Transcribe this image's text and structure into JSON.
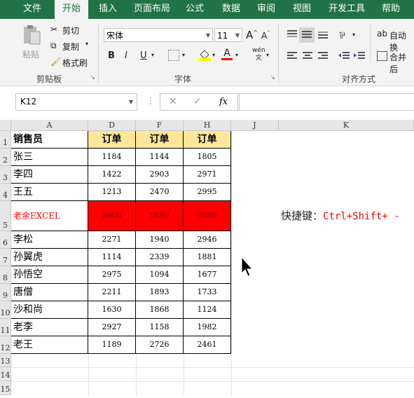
{
  "tabs": [
    "文件",
    "开始",
    "插入",
    "页面布局",
    "公式",
    "数据",
    "审阅",
    "视图",
    "开发工具",
    "帮助"
  ],
  "active_tab": "开始",
  "clipboard": {
    "paste": "粘贴",
    "cut": "剪切",
    "copy": "复制",
    "format_painter": "格式刷",
    "group": "剪贴板"
  },
  "font": {
    "name": "宋体",
    "size": "11",
    "bold": "B",
    "italic": "I",
    "underline": "U",
    "wen": "wén\n文",
    "group": "字体"
  },
  "align": {
    "wrap": "自动换",
    "merge": "合并后",
    "group": "对齐方式"
  },
  "name_box": "K12",
  "fx": "fx",
  "columns": [
    "A",
    "D",
    "F",
    "H",
    "J",
    "K"
  ],
  "rows": [
    "1",
    "2",
    "3",
    "4",
    "5",
    "6",
    "7",
    "8",
    "9",
    "10",
    "11",
    "12",
    "13",
    "14",
    "15"
  ],
  "table": {
    "header": [
      "销售员",
      "订单",
      "订单",
      "订单"
    ],
    "data": [
      [
        "张三",
        "1184",
        "1144",
        "1805"
      ],
      [
        "李四",
        "1422",
        "2903",
        "2971"
      ],
      [
        "王五",
        "1213",
        "2470",
        "2995"
      ],
      [
        "老余EXCEL",
        "3600",
        "5890",
        "9000"
      ],
      [
        "李松",
        "2271",
        "1940",
        "2946"
      ],
      [
        "孙翼虎",
        "1114",
        "2339",
        "1881"
      ],
      [
        "孙悟空",
        "2975",
        "1094",
        "1677"
      ],
      [
        "唐僧",
        "2211",
        "1893",
        "1733"
      ],
      [
        "沙和尚",
        "1630",
        "1868",
        "1124"
      ],
      [
        "老李",
        "2927",
        "1158",
        "1982"
      ],
      [
        "老王",
        "1189",
        "2726",
        "2461"
      ]
    ]
  },
  "shortcut": {
    "label": "快捷键：",
    "keys": "Ctrl+Shift+ -"
  },
  "colors": {
    "ribbon": "#217346",
    "header_fill": "#ffe699",
    "highlight": "#ff0000"
  }
}
